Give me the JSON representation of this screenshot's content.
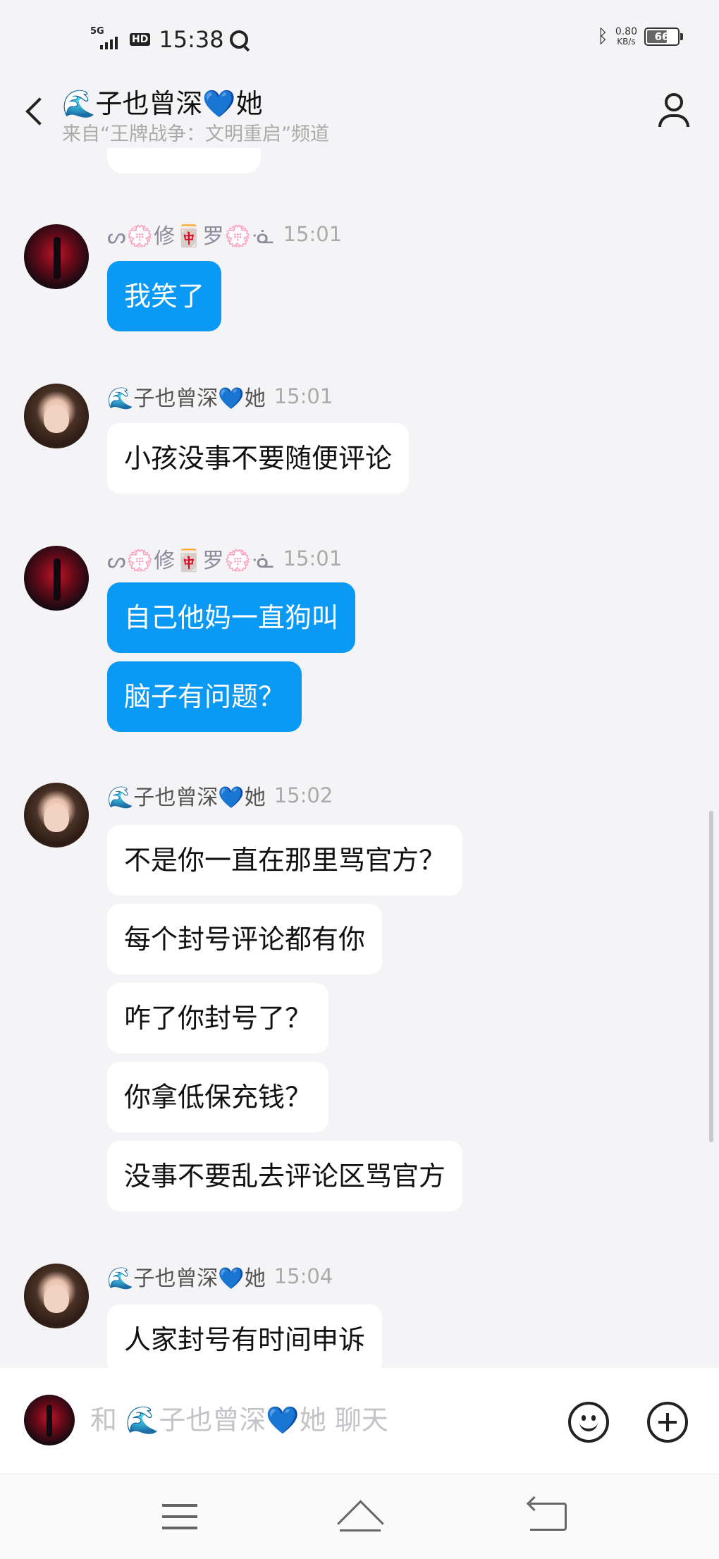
{
  "status_bar": {
    "network": "5G",
    "hd": "HD",
    "time": "15:38",
    "speed_value": "0.80",
    "speed_unit": "KB/s",
    "battery": "66"
  },
  "header": {
    "title": "🌊子也曾深💙她",
    "subtitle": "来自“王牌战争：文明重启”频道"
  },
  "messages": [
    {
      "sender": "ᔕ💮修🀄罗💮ᓍ",
      "time": "15:01",
      "avatar_icon": "red-figure-avatar",
      "side": "blue",
      "bubbles": [
        "我笑了"
      ]
    },
    {
      "sender": "🌊子也曾深💙她",
      "time": "15:01",
      "avatar_icon": "girl-avatar",
      "side": "white",
      "bubbles": [
        "小孩没事不要随便评论"
      ]
    },
    {
      "sender": "ᔕ💮修🀄罗💮ᓍ",
      "time": "15:01",
      "avatar_icon": "red-figure-avatar",
      "side": "blue",
      "bubbles": [
        "自己他妈一直狗叫",
        "脑子有问题？"
      ]
    },
    {
      "sender": "🌊子也曾深💙她",
      "time": "15:02",
      "avatar_icon": "girl-avatar",
      "side": "white",
      "bubbles": [
        "不是你一直在那里骂官方？",
        "每个封号评论都有你",
        "咋了你封号了？",
        "你拿低保充钱？",
        "没事不要乱去评论区骂官方"
      ]
    },
    {
      "sender": "🌊子也曾深💙她",
      "time": "15:04",
      "avatar_icon": "girl-avatar",
      "side": "white",
      "bubbles": [
        "人家封号有时间申诉"
      ]
    }
  ],
  "input": {
    "placeholder": "和 🌊子也曾深💙她 聊天"
  },
  "colors": {
    "accent_blue": "#0a99f5",
    "background": "#f4f4f6"
  }
}
